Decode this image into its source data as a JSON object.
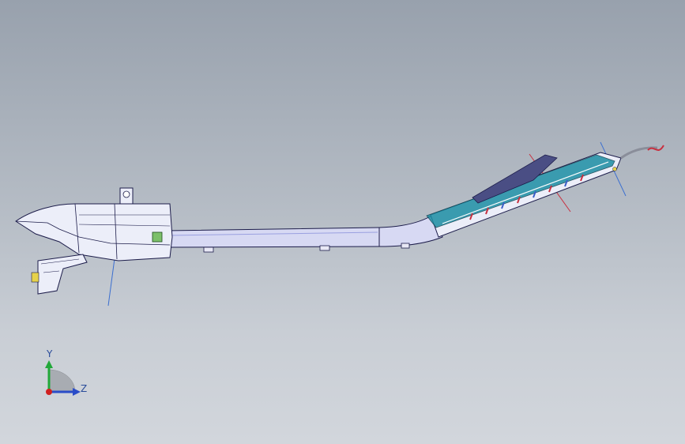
{
  "viewport": {
    "background_top": "#98a1ad",
    "background_bottom": "#d2d6dc",
    "model_outline_color": "#1c1c4a",
    "model_fill_color": "#eceef9",
    "tube_fill_color": "#d7d9f3",
    "accent_teal": "#1c8da3",
    "accent_red": "#c83040"
  },
  "triad": {
    "y_label": "Y",
    "z_label": "Z",
    "y_color": "#22a83a",
    "z_color": "#2a4cc8",
    "x_color": "#d02020"
  }
}
